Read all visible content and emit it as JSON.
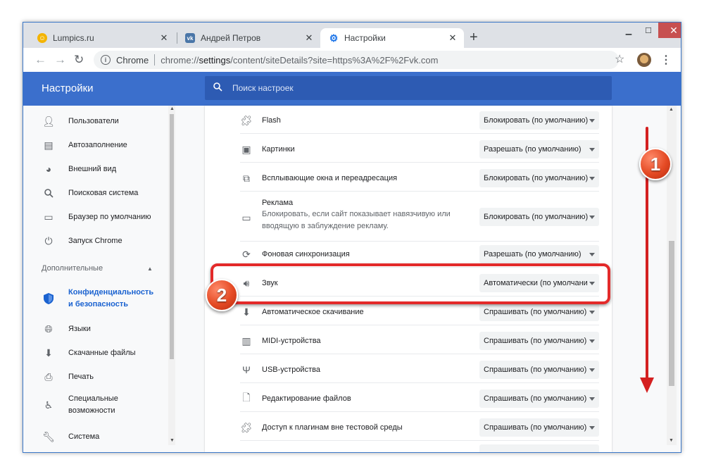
{
  "tabs": [
    {
      "title": "Lumpics.ru",
      "icon": "lumpics-icon"
    },
    {
      "title": "Андрей Петров",
      "icon": "vk-icon"
    },
    {
      "title": "Настройки",
      "icon": "gear-icon"
    }
  ],
  "omnibox": {
    "chip": "Chrome",
    "url_prefix": "chrome://",
    "url_main": "settings",
    "url_rest": "/content/siteDetails?site=https%3A%2F%2Fvk.com"
  },
  "header": {
    "title": "Настройки",
    "search_placeholder": "Поиск настроек"
  },
  "sidebar": {
    "items": [
      {
        "label": "Пользователи",
        "icon": "person-icon"
      },
      {
        "label": "Автозаполнение",
        "icon": "clipboard-icon"
      },
      {
        "label": "Внешний вид",
        "icon": "palette-icon"
      },
      {
        "label": "Поисковая система",
        "icon": "search-icon"
      },
      {
        "label": "Браузер по умолчанию",
        "icon": "browser-icon"
      },
      {
        "label": "Запуск Chrome",
        "icon": "power-icon"
      }
    ],
    "section": "Дополнительные",
    "advanced": [
      {
        "label": "Конфиденциальность и безопасность",
        "icon": "shield-icon",
        "active": true
      },
      {
        "label": "Языки",
        "icon": "globe-icon"
      },
      {
        "label": "Скачанные файлы",
        "icon": "download-icon"
      },
      {
        "label": "Печать",
        "icon": "printer-icon"
      },
      {
        "label": "Специальные возможности",
        "icon": "accessibility-icon"
      },
      {
        "label": "Система",
        "icon": "wrench-icon"
      }
    ]
  },
  "permissions": [
    {
      "label": "Flash",
      "icon": "puzzle-icon",
      "value": "Блокировать (по умолчанию)"
    },
    {
      "label": "Картинки",
      "icon": "image-icon",
      "value": "Разрешать (по умолчанию)"
    },
    {
      "label": "Всплывающие окна и переадресация",
      "icon": "open-in-new-icon",
      "value": "Блокировать (по умолчанию)"
    },
    {
      "label": "Реклама",
      "sublabel": "Блокировать, если сайт показывает навязчивую или вводящую в заблуждение рекламу.",
      "icon": "ad-icon",
      "value": "Блокировать (по умолчанию)"
    },
    {
      "label": "Фоновая синхронизация",
      "icon": "sync-icon",
      "value": "Разрешать (по умолчанию)"
    },
    {
      "label": "Звук",
      "icon": "speaker-icon",
      "value": "Автоматически (по умолчанию)"
    },
    {
      "label": "Автоматическое скачивание",
      "icon": "download-icon",
      "value": "Спрашивать (по умолчанию)"
    },
    {
      "label": "MIDI-устройства",
      "icon": "piano-icon",
      "value": "Спрашивать (по умолчанию)"
    },
    {
      "label": "USB-устройства",
      "icon": "usb-icon",
      "value": "Спрашивать (по умолчанию)"
    },
    {
      "label": "Редактирование файлов",
      "icon": "file-edit-icon",
      "value": "Спрашивать (по умолчанию)"
    },
    {
      "label": "Доступ к плагинам вне тестовой среды",
      "icon": "puzzle-icon",
      "value": "Спрашивать (по умолчанию)"
    }
  ],
  "annotations": {
    "badge1": "1",
    "badge2": "2",
    "color": "#e32a2a"
  }
}
